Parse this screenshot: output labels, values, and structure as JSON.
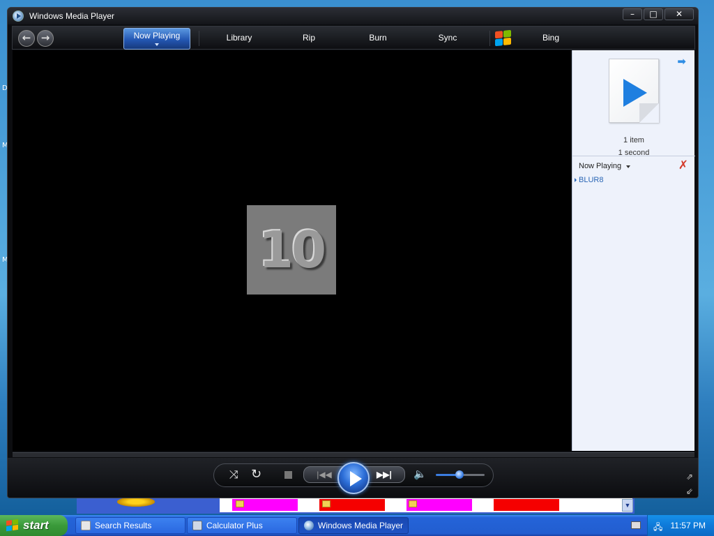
{
  "window": {
    "title": "Windows Media Player",
    "controls": {
      "minimize": "–",
      "maximize": "□",
      "close": "✕"
    }
  },
  "nav": {
    "back_label": "←",
    "forward_label": "→",
    "tabs": [
      {
        "label": "Now Playing",
        "active": true
      },
      {
        "label": "Library",
        "active": false
      },
      {
        "label": "Rip",
        "active": false
      },
      {
        "label": "Burn",
        "active": false
      },
      {
        "label": "Sync",
        "active": false
      },
      {
        "label": "Bing",
        "active": false
      }
    ]
  },
  "video": {
    "frame_text": "10"
  },
  "pane": {
    "item_count": "1 item",
    "duration": "1 second",
    "list_title": "Now Playing",
    "items": [
      {
        "label": "BLUR8"
      }
    ]
  },
  "player": {
    "shuffle_icon": "⤨",
    "repeat_icon": "↻",
    "prev_icon": "|◀◀",
    "next_icon": "▶▶|",
    "mute_icon": "🔈",
    "volume_level": 0.48
  },
  "desktop": {
    "side_letters": [
      "D",
      "M",
      "M"
    ]
  },
  "taskbar": {
    "start_label": "start",
    "tasks": [
      {
        "label": "Search Results",
        "active": false
      },
      {
        "label": "Calculator Plus",
        "active": false
      },
      {
        "label": "Windows Media Player",
        "active": true
      }
    ],
    "clock": "11:57 PM"
  },
  "colors": {
    "accent_blue": "#2457b3",
    "playlist_link": "#2a66b5",
    "taskbar_blue": "#225ed0",
    "start_green": "#3a9a3a"
  }
}
